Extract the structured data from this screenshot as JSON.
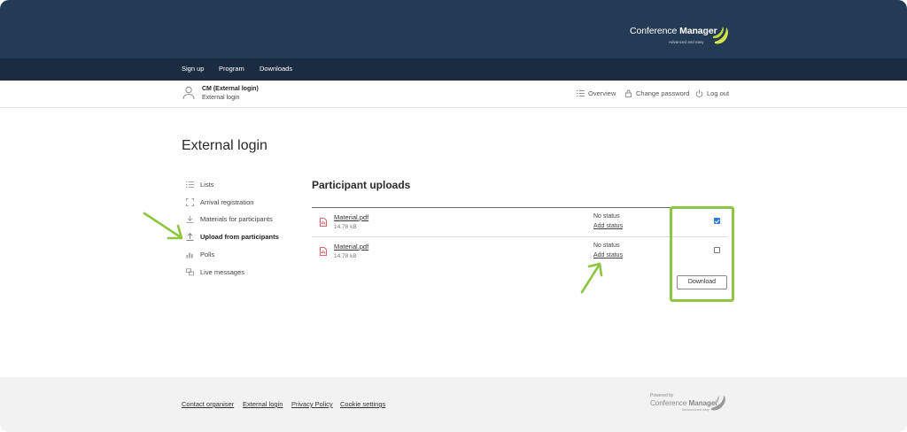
{
  "brand": {
    "name_regular": "Conference ",
    "name_bold": "Manager",
    "tagline": "Advanced and easy",
    "accent_color": "#d4e34a"
  },
  "nav": {
    "items": [
      "Sign up",
      "Program",
      "Downloads"
    ]
  },
  "user": {
    "name": "CM (External login)",
    "role": "External login",
    "links": {
      "overview": "Overview",
      "change_password": "Change password",
      "logout": "Log out"
    }
  },
  "page": {
    "title": "External login"
  },
  "sidebar": {
    "items": [
      {
        "label": "Lists",
        "icon": "list-icon"
      },
      {
        "label": "Arrival registration",
        "icon": "scan-icon"
      },
      {
        "label": "Materials for participants",
        "icon": "download-icon"
      },
      {
        "label": "Upload from participants",
        "icon": "upload-icon",
        "active": true
      },
      {
        "label": "Polls",
        "icon": "bar-chart-icon"
      },
      {
        "label": "Live messages",
        "icon": "chat-icon"
      }
    ]
  },
  "uploads": {
    "title": "Participant uploads",
    "rows": [
      {
        "file": "Material.pdf",
        "size": "14.78 kB",
        "status": "No status",
        "action": "Add status",
        "checked": true
      },
      {
        "file": "Material.pdf",
        "size": "14.78 kB",
        "status": "No status",
        "action": "Add status",
        "checked": false
      }
    ],
    "download_label": "Download",
    "highlight_color": "#8dc63f"
  },
  "footer": {
    "links": [
      "Contact organiser",
      "External login",
      "Privacy Policy",
      "Cookie settings"
    ],
    "powered_by": "Powered by",
    "brand_regular": "Conference ",
    "brand_bold": "Manager",
    "brand_tagline": "Advanced and easy"
  }
}
